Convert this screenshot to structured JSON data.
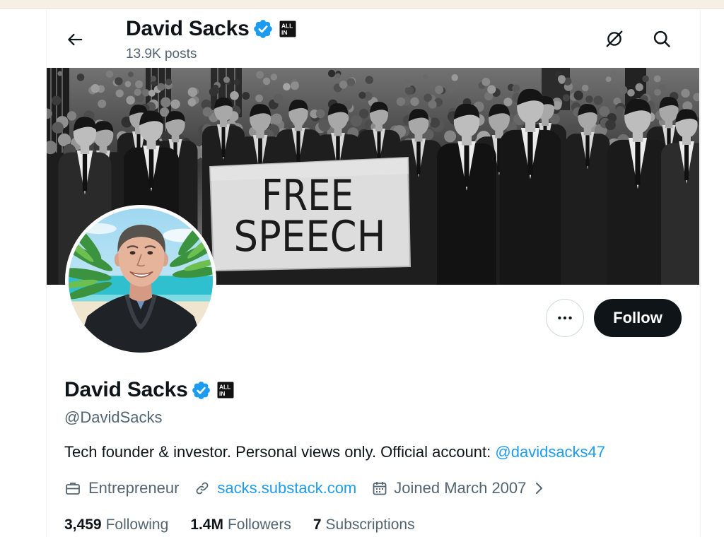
{
  "colors": {
    "text": "#0f1419",
    "muted": "#536471",
    "accent": "#1d9bf0",
    "button_bg": "#0f1419",
    "border": "#cfd9de",
    "top_strip": "#f6efe5"
  },
  "header": {
    "back_icon": "arrow-left-icon",
    "title": "David Sacks",
    "posts_count": "13.9K posts",
    "right_icons": [
      "grok-icon",
      "search-icon"
    ]
  },
  "badges": {
    "verified_icon": "verified-badge-icon",
    "affiliate_line1": "ALL",
    "affiliate_line2": "IN"
  },
  "banner": {
    "sign_line1": "FREE",
    "sign_line2": "SPEECH"
  },
  "actions": {
    "more_icon": "more-horizontal-icon",
    "follow_label": "Follow"
  },
  "profile": {
    "name": "David Sacks",
    "handle": "@DavidSacks",
    "bio_text": "Tech founder & investor. Personal views only. Official account: ",
    "bio_mention": "@davidsacks47"
  },
  "meta": {
    "occupation_icon": "briefcase-icon",
    "occupation": "Entrepreneur",
    "website_icon": "link-icon",
    "website": "sacks.substack.com",
    "joined_icon": "calendar-icon",
    "joined": "Joined March 2007",
    "joined_more_icon": "chevron-right-icon"
  },
  "stats": [
    {
      "value": "3,459",
      "label": "Following"
    },
    {
      "value": "1.4M",
      "label": "Followers"
    },
    {
      "value": "7",
      "label": "Subscriptions"
    }
  ]
}
